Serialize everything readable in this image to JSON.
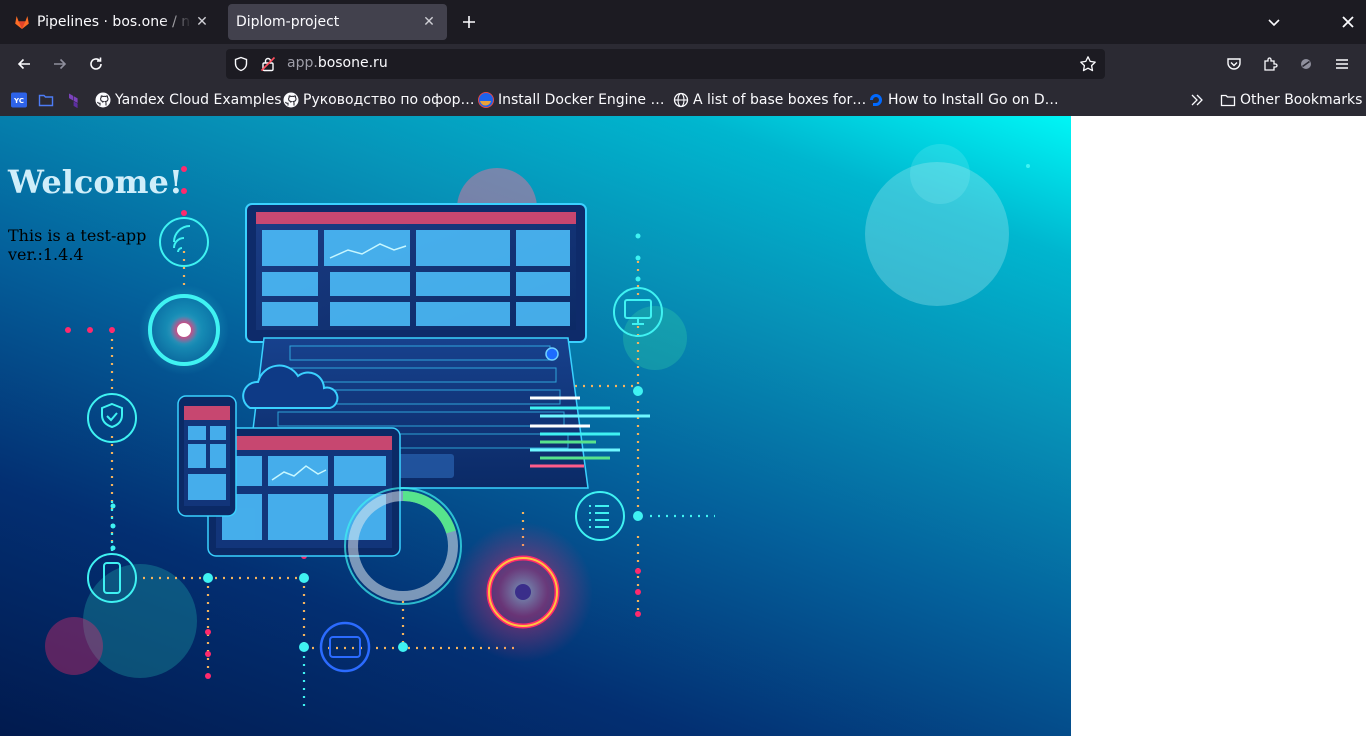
{
  "tabs": [
    {
      "title": "Pipelines · bos.one / netology",
      "icon": "gitlab-icon",
      "active": false
    },
    {
      "title": "Diplom-project",
      "icon": "",
      "active": true
    }
  ],
  "address_bar": {
    "host_prefix": "app.",
    "host_domain": "bosone.ru"
  },
  "bookmarks": [
    {
      "label": "",
      "icon": "yandex-cloud-icon"
    },
    {
      "label": "",
      "icon": "folder-icon"
    },
    {
      "label": "",
      "icon": "terraform-icon"
    },
    {
      "label": "Yandex Cloud Examples",
      "icon": "github-icon"
    },
    {
      "label": "Руководство по офор…",
      "icon": "github-icon"
    },
    {
      "label": "Install Docker Engine …",
      "icon": "docker-icon"
    },
    {
      "label": "A list of base boxes for…",
      "icon": "globe-icon"
    },
    {
      "label": "How to Install Go on D…",
      "icon": "digitalocean-icon"
    }
  ],
  "other_bookmarks": "Other Bookmarks",
  "page": {
    "heading": "Welcome!",
    "line1": "This is a test-app",
    "line2": "ver.:1.4.4"
  },
  "colors": {
    "chrome_dark": "#1c1b22",
    "chrome": "#2b2a33",
    "active_tab": "#42414d",
    "hero_cyan": "#00f6f6",
    "hero_navy": "#011a4e",
    "neon_pink": "#ff2a6d",
    "neon_cyan": "#3ff2f2"
  }
}
